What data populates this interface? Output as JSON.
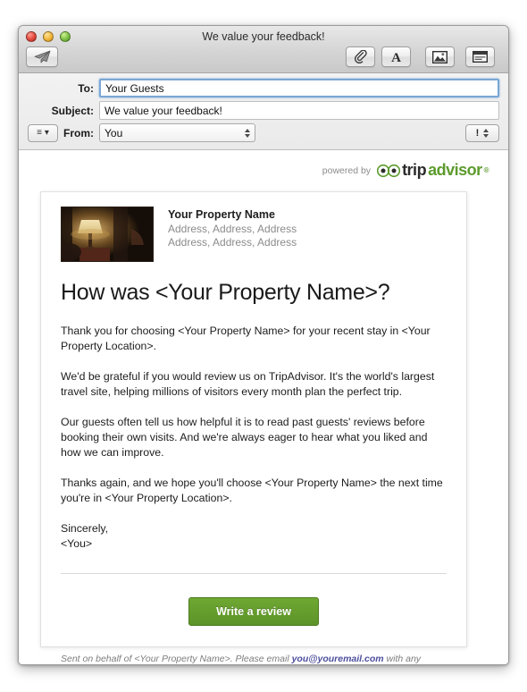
{
  "window": {
    "title": "We value your feedback!",
    "traffic_lights": [
      "close-red",
      "minimize-yellow",
      "zoom-green"
    ],
    "colors": {
      "red": "#e2483c",
      "yellow": "#f0b43a",
      "green": "#7dc044",
      "accent_green": "#5d9b2d",
      "link_purple": "#4d4f9e"
    }
  },
  "toolbar": {
    "send_icon": "paper-plane-icon",
    "attach_icon": "paperclip-icon",
    "fonts_icon": "font-letter-a-icon",
    "photo_icon": "photo-browser-icon",
    "stationery_icon": "stationery-icon"
  },
  "header_fields": {
    "to": {
      "label": "To:",
      "value": "Your Guests"
    },
    "subject": {
      "label": "Subject:",
      "value": "We value your feedback!"
    },
    "from": {
      "label": "From:",
      "value": "You"
    },
    "menu_button": "≡",
    "menu_caret": "▾",
    "priority": "!"
  },
  "message": {
    "powered_by": "powered by",
    "brand": {
      "part1": "trip",
      "part2": "advisor",
      "reg": "®"
    },
    "property": {
      "name": "Your Property Name",
      "address_line1": "Address, Address, Address",
      "address_line2": "Address, Address, Address",
      "photo": "hotel-room-lamp-photo"
    },
    "headline": "How was <Your Property Name>?",
    "paragraphs": [
      "Thank you for choosing <Your Property Name> for your recent stay in <Your Property Location>.",
      "We'd be grateful if you would review us on TripAdvisor. It's the world's largest travel site, helping millions of visitors every month plan the perfect trip.",
      "Our guests often tell us how helpful it is to read past guests' reviews before booking their own visits. And we're always eager to hear what you liked and how we can improve.",
      "Thanks again, and we hope you'll choose <Your Property Name> the next time you're in <Your Property Location>."
    ],
    "signoff": "Sincerely,",
    "signature": "<You>",
    "cta_label": "Write a review",
    "footnote_before": "Sent on behalf of <Your Property Name>. Please email ",
    "footnote_email": "you@youremail.com",
    "footnote_after": " with any comments or questions."
  }
}
